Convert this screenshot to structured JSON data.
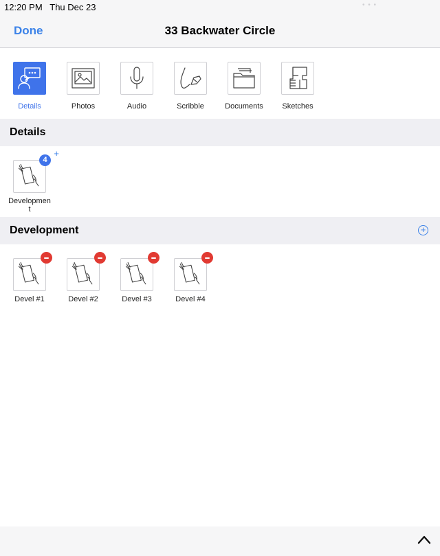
{
  "status": {
    "time": "12:20 PM",
    "date": "Thu Dec 23",
    "dots": "• • •"
  },
  "nav": {
    "done_label": "Done",
    "title": "33 Backwater Circle"
  },
  "tabs": [
    {
      "label": "Details",
      "icon": "details-icon",
      "active": true
    },
    {
      "label": "Photos",
      "icon": "photos-icon"
    },
    {
      "label": "Audio",
      "icon": "microphone-icon"
    },
    {
      "label": "Scribble",
      "icon": "scribble-pen-icon"
    },
    {
      "label": "Documents",
      "icon": "folder-icon"
    },
    {
      "label": "Sketches",
      "icon": "floor-plan-icon"
    }
  ],
  "details_section": {
    "title": "Details",
    "items": [
      {
        "label": "Development",
        "badge_count": "4",
        "badge_plus": "+",
        "icon": "tablet-hand-icon"
      }
    ]
  },
  "development_section": {
    "title": "Development",
    "add_icon": "add-circle-icon",
    "add_glyph": "+",
    "items": [
      {
        "label": "Devel #1",
        "icon": "tablet-hand-icon"
      },
      {
        "label": "Devel #2",
        "icon": "tablet-hand-icon"
      },
      {
        "label": "Devel #3",
        "icon": "tablet-hand-icon"
      },
      {
        "label": "Devel #4",
        "icon": "tablet-hand-icon"
      }
    ]
  },
  "bottom": {
    "collapse_icon": "chevron-up-icon"
  },
  "colors": {
    "accent": "#3f73ea",
    "link": "#3b82e8",
    "remove": "#e13a32",
    "section_bg": "#efeff3"
  }
}
